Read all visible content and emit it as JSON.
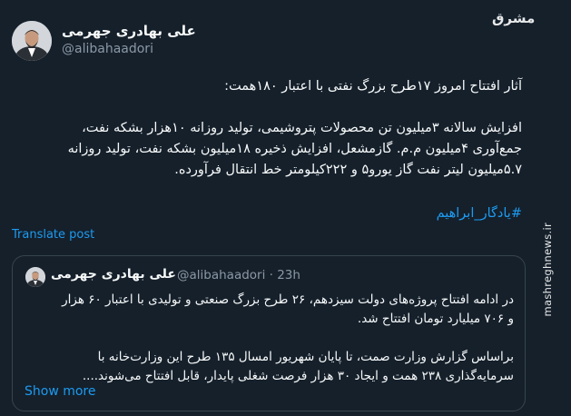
{
  "author": {
    "name": "علی بهادری جهرمی",
    "handle": "@alibahaadori"
  },
  "tweet": {
    "lines_1": [
      "آثار افتتاح امروز ۱۷طرح بزرگ نفتی با اعتبار ۱۸۰همت:"
    ],
    "lines_2": [
      "افزایش سالانه ۳میلیون تن محصولات پتروشیمی، تولید روزانه ۱۰هزار بشکه نفت،",
      "جمع‌آوری ۴میلیون م.م. گازمشعل، افزایش ذخیره ۱۸میلیون بشکه نفت، تولید روزانه",
      "۵.۷میلیون لیتر نفت گاز یورو۵ و ۲۲۲کیلومتر خط انتقال فرآورده."
    ],
    "hashtag": "#یادگار_ابراهیم"
  },
  "translate_label": "Translate post",
  "quote": {
    "name": "علی بهادری جهرمی",
    "handle": "@alibahaadori · 23h",
    "lines_1": [
      "در ادامه افتتاح پروژه‌های دولت سیزدهم، ۲۶ طرح بزرگ صنعتی و تولیدی با اعتبار ۶۰ هزار",
      "و ۷۰۶ میلیارد تومان افتتاح شد."
    ],
    "lines_2": [
      "براساس گزارش وزارت صمت، تا پایان شهریور امسال ۱۳۵ طرح این وزارت‌خانه با",
      "سرمایه‌گذاری ۲۳۸ همت و ایجاد ۳۰ هزار فرصت شغلی پایدار، قابل افتتاح می‌شوند...."
    ],
    "show_more": "Show more"
  },
  "watermark": {
    "logo": "مشرق",
    "url": "mashreghnews.ir"
  }
}
